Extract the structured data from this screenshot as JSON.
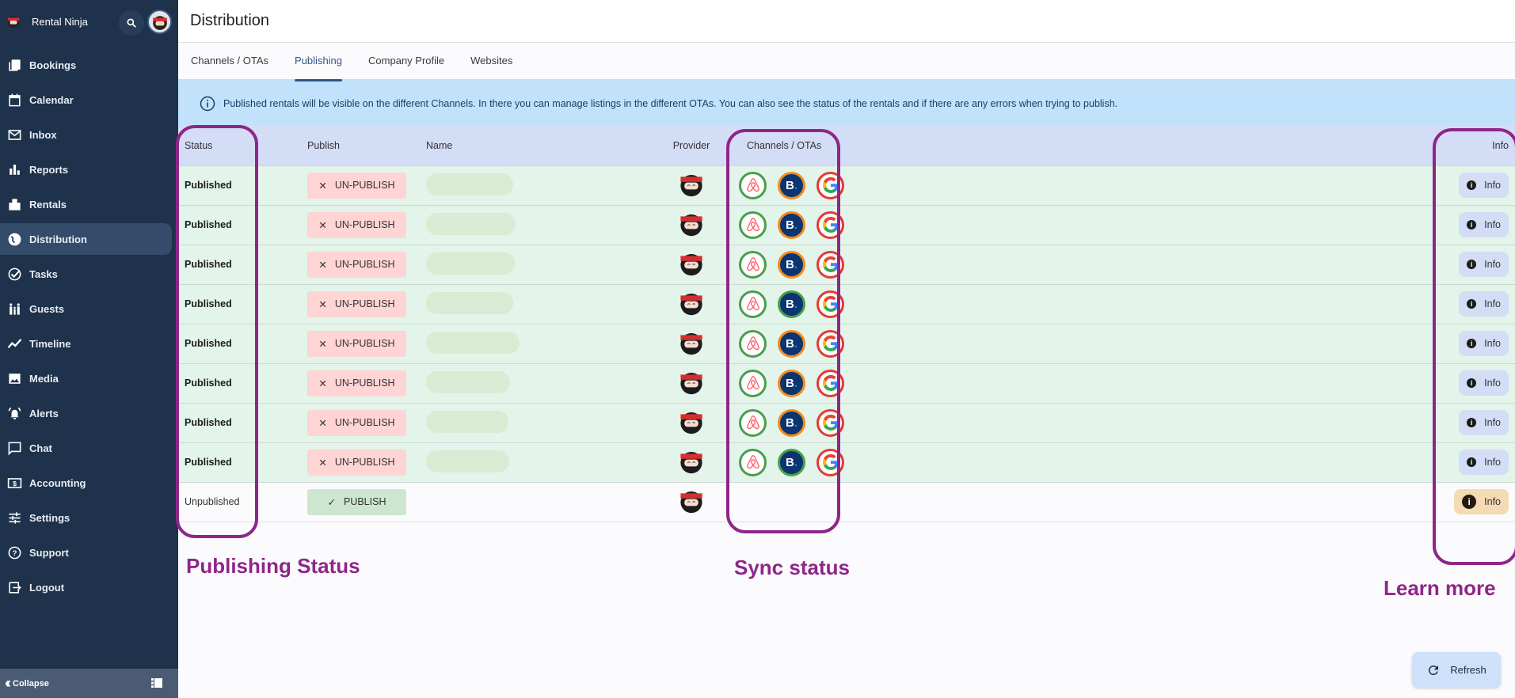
{
  "app": {
    "name": "Rental Ninja"
  },
  "sidebar": {
    "items": [
      {
        "label": "Bookings",
        "icon": "bookings-icon"
      },
      {
        "label": "Calendar",
        "icon": "calendar-icon"
      },
      {
        "label": "Inbox",
        "icon": "inbox-icon"
      },
      {
        "label": "Reports",
        "icon": "reports-icon"
      },
      {
        "label": "Rentals",
        "icon": "rentals-icon"
      },
      {
        "label": "Distribution",
        "icon": "globe-icon",
        "active": true
      },
      {
        "label": "Tasks",
        "icon": "tasks-icon"
      },
      {
        "label": "Guests",
        "icon": "guests-icon"
      },
      {
        "label": "Timeline",
        "icon": "timeline-icon"
      },
      {
        "label": "Media",
        "icon": "media-icon"
      },
      {
        "label": "Alerts",
        "icon": "alerts-icon"
      },
      {
        "label": "Chat",
        "icon": "chat-icon"
      },
      {
        "label": "Accounting",
        "icon": "accounting-icon"
      },
      {
        "label": "Settings",
        "icon": "settings-icon"
      },
      {
        "label": "Support",
        "icon": "support-icon"
      },
      {
        "label": "Logout",
        "icon": "logout-icon"
      }
    ],
    "collapse_label": "Collapse"
  },
  "header": {
    "title": "Distribution"
  },
  "tabs": [
    {
      "label": "Channels / OTAs"
    },
    {
      "label": "Publishing",
      "active": true
    },
    {
      "label": "Company Profile"
    },
    {
      "label": "Websites"
    }
  ],
  "banner": {
    "text": "Published rentals will be visible on the different Channels. In there you can manage listings in the different OTAs. You can also see the status of the rentals and if there are any errors when trying to publish."
  },
  "table": {
    "headers": {
      "status": "Status",
      "publish": "Publish",
      "name": "Name",
      "provider": "Provider",
      "channels": "Channels / OTAs",
      "info": "Info"
    },
    "rows": [
      {
        "status": "Published",
        "action": "UN-PUBLISH",
        "channels": {
          "airbnb": "ok",
          "booking": "pending",
          "google": "error"
        },
        "info": "Info"
      },
      {
        "status": "Published",
        "action": "UN-PUBLISH",
        "channels": {
          "airbnb": "ok",
          "booking": "pending",
          "google": "error"
        },
        "info": "Info"
      },
      {
        "status": "Published",
        "action": "UN-PUBLISH",
        "channels": {
          "airbnb": "ok",
          "booking": "pending",
          "google": "error"
        },
        "info": "Info"
      },
      {
        "status": "Published",
        "action": "UN-PUBLISH",
        "channels": {
          "airbnb": "ok",
          "booking": "ok",
          "google": "error"
        },
        "info": "Info"
      },
      {
        "status": "Published",
        "action": "UN-PUBLISH",
        "channels": {
          "airbnb": "ok",
          "booking": "pending",
          "google": "error"
        },
        "info": "Info"
      },
      {
        "status": "Published",
        "action": "UN-PUBLISH",
        "channels": {
          "airbnb": "ok",
          "booking": "pending",
          "google": "error"
        },
        "info": "Info"
      },
      {
        "status": "Published",
        "action": "UN-PUBLISH",
        "channels": {
          "airbnb": "ok",
          "booking": "pending",
          "google": "error"
        },
        "info": "Info"
      },
      {
        "status": "Published",
        "action": "UN-PUBLISH",
        "channels": {
          "airbnb": "ok",
          "booking": "ok",
          "google": "error"
        },
        "info": "Info"
      },
      {
        "status": "Unpublished",
        "action": "PUBLISH",
        "channels": null,
        "info": "Info"
      }
    ]
  },
  "status_colors": {
    "ok": "#4a9e4c",
    "pending": "#f28c1c",
    "error": "#e53935"
  },
  "annotations": {
    "publishing_status": "Publishing Status",
    "sync_status": "Sync status",
    "learn_more": "Learn more"
  },
  "refresh_label": "Refresh"
}
